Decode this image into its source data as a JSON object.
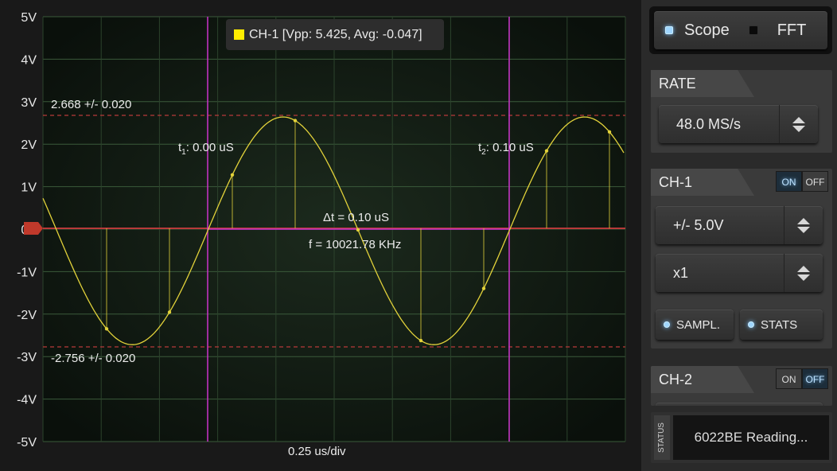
{
  "plot": {
    "y_labels": [
      "5V",
      "4V",
      "3V",
      "2V",
      "1V",
      "0V",
      "-1V",
      "-2V",
      "-3V",
      "-4V",
      "-5V"
    ],
    "time_div": "0.25 us/div",
    "upper_level_text": "2.668 +/- 0.020",
    "lower_level_text": "-2.756 +/- 0.020",
    "t1_sub": "1",
    "t1_value": ": 0.00 uS",
    "t2_sub": "2",
    "t2_value": ": 0.10 uS",
    "t_prefix": "t",
    "delta_text": "Δt = 0.10 uS",
    "freq_text": "f = 10021.78 KHz",
    "marker_color": "#cc33cc",
    "trace_color": "#e2d23a",
    "level_color": "#b83a3a"
  },
  "legend": {
    "text": "CH-1 [Vpp: 5.425, Avg: -0.047]",
    "swatch_color": "#ffee00"
  },
  "chart_data": {
    "type": "line",
    "title": "",
    "xlabel": "0.25 us/div",
    "ylabel": "",
    "ylim": [
      -5,
      5
    ],
    "grid": true,
    "series": [
      {
        "name": "CH-1",
        "x_us": [
          0.0,
          0.025,
          0.05,
          0.075,
          0.1,
          0.125,
          0.15,
          0.175,
          0.2,
          0.225,
          0.25,
          0.275,
          0.3,
          0.325,
          0.35,
          0.375,
          0.4,
          0.425,
          0.45,
          0.475,
          0.5,
          0.525,
          0.55,
          0.575,
          0.6,
          0.625,
          0.65,
          0.675,
          0.7,
          0.725,
          0.75,
          0.775,
          0.8,
          0.825,
          0.85,
          0.875,
          0.9,
          0.925,
          0.95,
          0.975,
          1.0
        ],
        "values": [
          0.6,
          -0.5,
          -1.5,
          -2.3,
          -2.7,
          -2.6,
          -2.1,
          -1.2,
          -0.1,
          1.0,
          2.0,
          2.5,
          2.6,
          2.2,
          1.3,
          0.2,
          -0.9,
          -1.9,
          -2.6,
          -2.7,
          -2.3,
          -1.5,
          -0.4,
          0.8,
          1.8,
          2.5,
          2.6,
          2.1,
          1.7
        ]
      }
    ]
  },
  "mode": {
    "scope_label": "Scope",
    "fft_label": "FFT",
    "led_on_color": "#9fd6ff"
  },
  "rate": {
    "tab": "RATE",
    "value": "48.0 MS/s"
  },
  "ch1": {
    "tab": "CH-1",
    "on": "ON",
    "off": "OFF",
    "range": "+/- 5.0V",
    "probe": "x1",
    "sampl": "SAMPL.",
    "stats": "STATS"
  },
  "ch2": {
    "tab": "CH-2",
    "on": "ON",
    "off": "OFF"
  },
  "status": {
    "label": "STATUS",
    "text": "6022BE Reading..."
  }
}
